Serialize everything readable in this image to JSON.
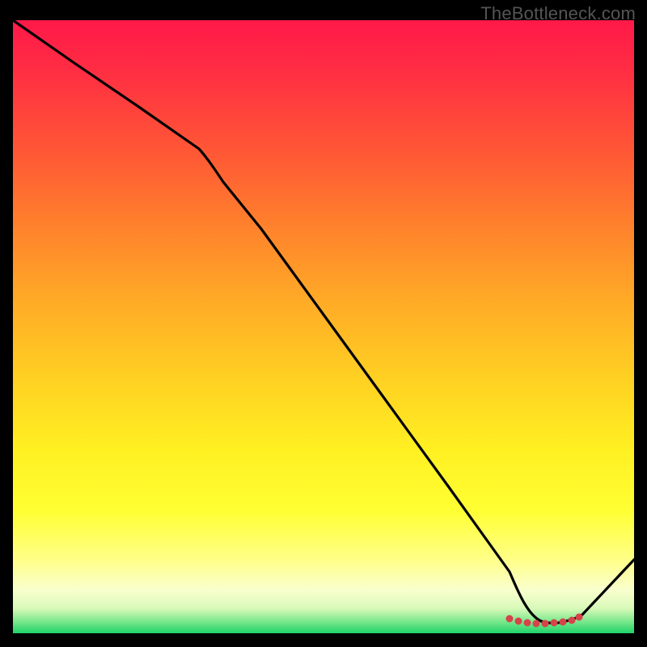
{
  "watermark": "TheBottleneck.com",
  "chart_data": {
    "type": "line",
    "title": "",
    "xlabel": "",
    "ylabel": "",
    "xlim": [
      0,
      100
    ],
    "ylim": [
      0,
      100
    ],
    "grid": false,
    "legend": false,
    "series": [
      {
        "name": "curve",
        "x": [
          0,
          10,
          20,
          30,
          40,
          50,
          60,
          70,
          80,
          85,
          90,
          100
        ],
        "y": [
          100,
          93,
          86,
          79,
          66,
          52,
          38,
          24,
          10,
          2,
          2,
          12
        ]
      }
    ],
    "markers": {
      "name": "trough-markers",
      "x": [
        80,
        82,
        84,
        86,
        88,
        90
      ],
      "y": [
        2,
        2,
        2,
        2,
        2,
        2
      ]
    },
    "gradient_stops": [
      {
        "pos": 0.0,
        "color": "#ff1948"
      },
      {
        "pos": 0.5,
        "color": "#ffc524"
      },
      {
        "pos": 0.85,
        "color": "#ffff55"
      },
      {
        "pos": 1.0,
        "color": "#1fd36a"
      }
    ]
  }
}
